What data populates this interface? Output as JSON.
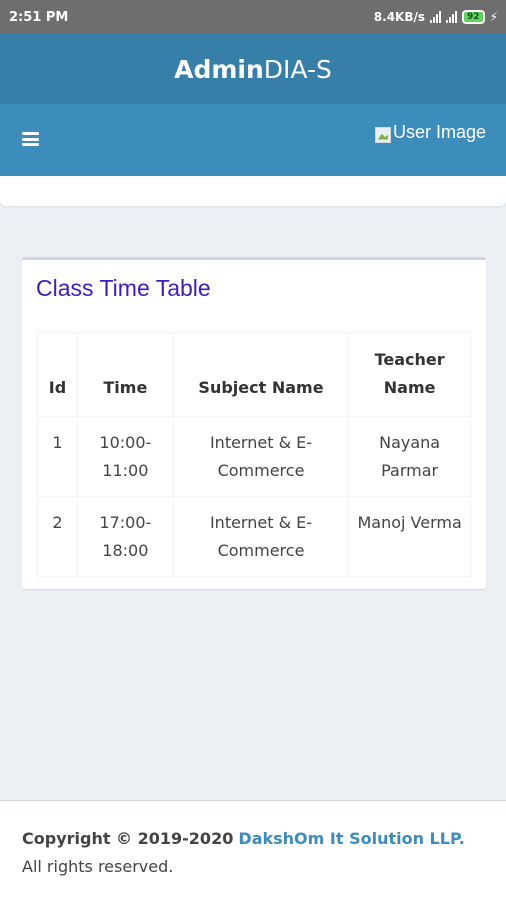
{
  "status_bar": {
    "time": "2:51 PM",
    "net_speed": "8.4KB/s",
    "battery": "92"
  },
  "header": {
    "logo_bold": "Admin",
    "logo_light": "DIA-S",
    "user_image_label": "User Image",
    "menu_icon": "hamburger-icon"
  },
  "card": {
    "title": "Class Time Table",
    "columns": [
      "Id",
      "Time",
      "Subject Name",
      "Teacher Name"
    ],
    "rows": [
      [
        "1",
        "10:00-11:00",
        "Internet & E-Commerce",
        "Nayana Parmar"
      ],
      [
        "2",
        "17:00-18:00",
        "Internet & E-Commerce",
        "Manoj Verma"
      ]
    ]
  },
  "footer": {
    "copyright": "Copyright © 2019-2020",
    "company": "DakshOm It Solution LLP.",
    "rights": "All rights reserved."
  },
  "colors": {
    "header_dark": "#367fa9",
    "header": "#3c8dbc",
    "title": "#3f1bc9",
    "link": "#3c8dbc",
    "background": "#ecf0f5"
  }
}
